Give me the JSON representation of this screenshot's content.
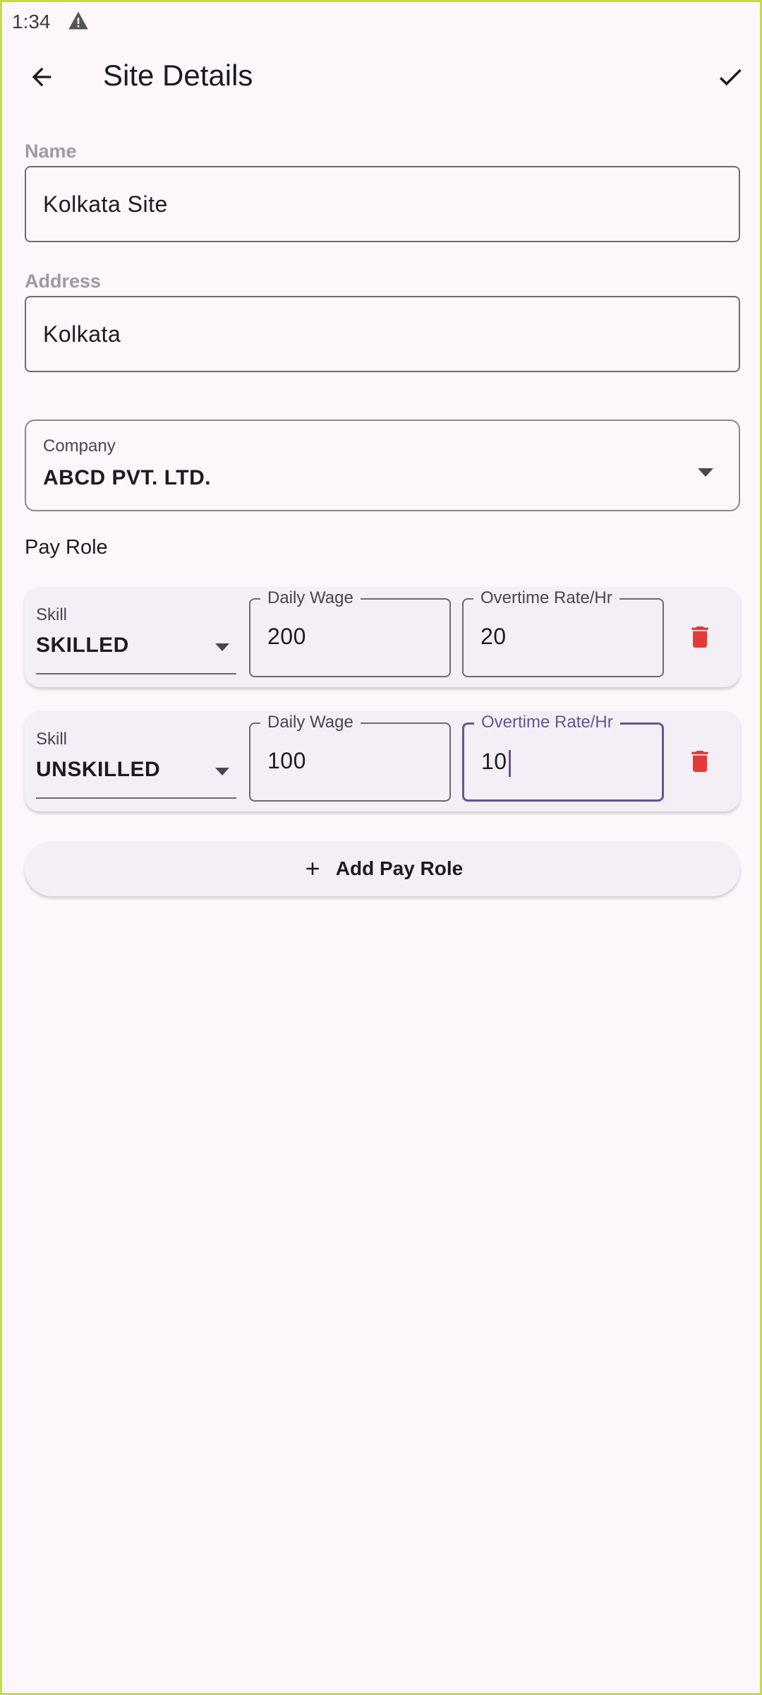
{
  "status": {
    "time": "1:34",
    "icons": [
      "warning-icon"
    ]
  },
  "app_bar": {
    "title": "Site Details",
    "back_icon": "arrow-back-icon",
    "action_icon": "check-icon"
  },
  "form": {
    "name": {
      "label": "Name",
      "value": "Kolkata Site"
    },
    "address": {
      "label": "Address",
      "value": "Kolkata"
    },
    "company": {
      "label": "Company",
      "value": "ABCD PVT. LTD."
    }
  },
  "pay_role": {
    "label": "Pay Role",
    "rows": [
      {
        "skill_label": "Skill",
        "skill": "SKILLED",
        "wage_label": "Daily Wage",
        "wage": "200",
        "ot_label": "Overtime Rate/Hr",
        "ot": "20"
      },
      {
        "skill_label": "Skill",
        "skill": "UNSKILLED",
        "wage_label": "Daily Wage",
        "wage": "100",
        "ot_label": "Overtime Rate/Hr",
        "ot": "10"
      }
    ],
    "add_label": "Add Pay Role"
  },
  "colors": {
    "accent": "#65558f",
    "delete": "#e53935",
    "background": "#fdf7fc",
    "card": "#f4eff6"
  }
}
